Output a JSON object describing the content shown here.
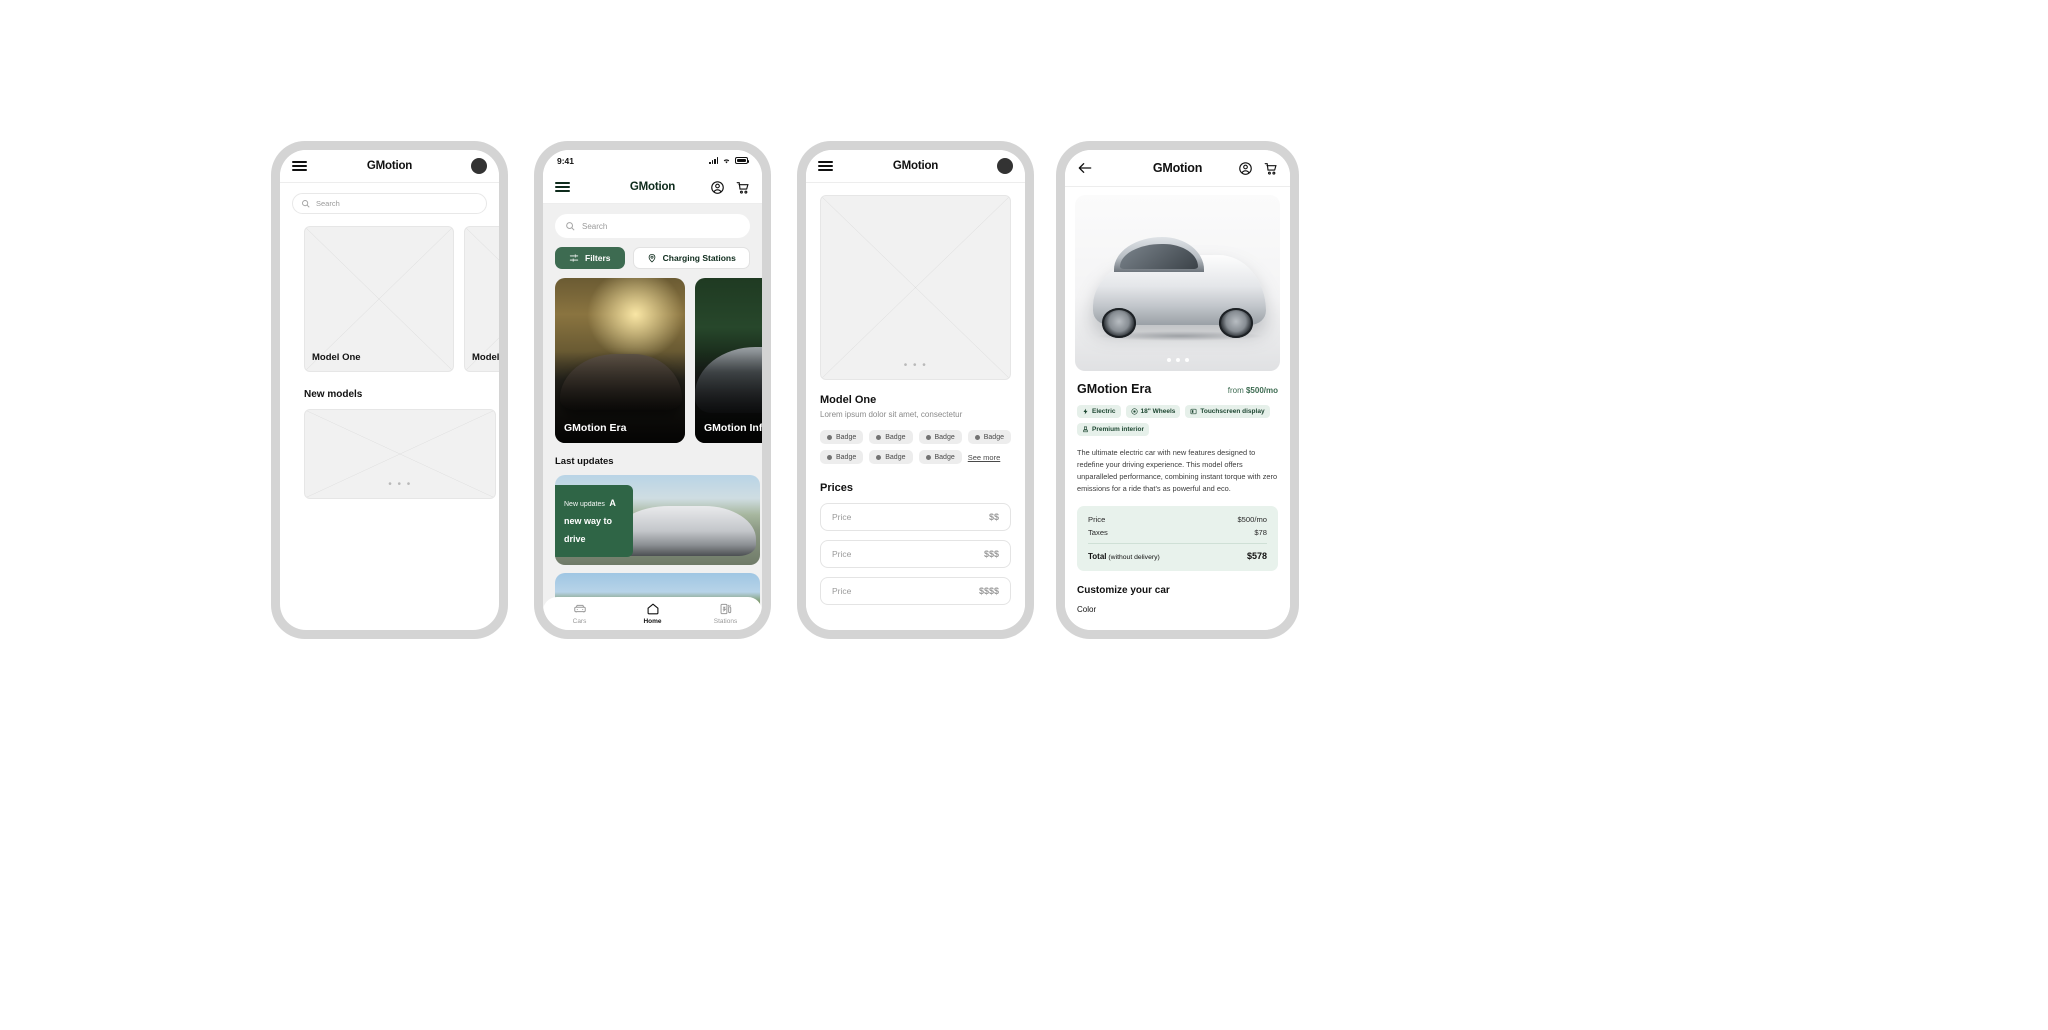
{
  "app": {
    "name": "GMotion"
  },
  "phone1": {
    "appbar": {
      "title": "GMotion",
      "menu_icon": "hamburger-icon",
      "avatar_icon": "avatar-icon"
    },
    "search": {
      "placeholder": "Search",
      "icon": "search-icon"
    },
    "cards": [
      {
        "label": "Model One"
      },
      {
        "label": "Model"
      }
    ],
    "section_title": "New models",
    "new_model_placeholder_dots": "• • •"
  },
  "phone2": {
    "statusbar": {
      "time": "9:41",
      "signal_icon": "cellular-signal-icon",
      "wifi_icon": "wifi-icon",
      "battery_icon": "battery-icon"
    },
    "appbar": {
      "title": "GMotion",
      "menu_icon": "hamburger-icon",
      "account_icon": "account-circle-icon",
      "cart_icon": "shopping-cart-icon"
    },
    "search": {
      "placeholder": "Search",
      "icon": "search-icon"
    },
    "buttons": [
      {
        "label": "Filters",
        "icon": "filter-sliders-icon",
        "style": "filled"
      },
      {
        "label": "Charging Stations",
        "icon": "map-pin-icon",
        "style": "outline"
      }
    ],
    "cards": [
      {
        "label": "GMotion Era"
      },
      {
        "label": "GMotion Infinity"
      }
    ],
    "last_updates_title": "Last updates",
    "update_banner": {
      "kicker": "New updates",
      "headline": "A new way to drive"
    },
    "tabbar": [
      {
        "label": "Cars",
        "icon": "car-icon",
        "active": false
      },
      {
        "label": "Home",
        "icon": "home-icon",
        "active": true
      },
      {
        "label": "Stations",
        "icon": "charging-station-icon",
        "active": false
      }
    ]
  },
  "phone3": {
    "appbar": {
      "title": "GMotion",
      "menu_icon": "hamburger-icon",
      "avatar_icon": "avatar-icon"
    },
    "hero_dots": "• • •",
    "title": "Model One",
    "subtitle": "Lorem ipsum dolor sit amet, consectetur",
    "badges": [
      "Badge",
      "Badge",
      "Badge",
      "Badge",
      "Badge",
      "Badge",
      "Badge"
    ],
    "see_more": "See more",
    "prices_title": "Prices",
    "price_fields": [
      {
        "label": "Price",
        "value": "$$"
      },
      {
        "label": "Price",
        "value": "$$$"
      },
      {
        "label": "Price",
        "value": "$$$$"
      }
    ]
  },
  "phone4": {
    "appbar": {
      "title": "GMotion",
      "back_icon": "arrow-left-icon",
      "account_icon": "account-circle-icon",
      "cart_icon": "shopping-cart-icon"
    },
    "gallery": {
      "dots": 3,
      "active_dot": 1
    },
    "name": "GMotion Era",
    "price_from_prefix": "from ",
    "price_from_value": "$500/mo",
    "feature_badges": [
      {
        "label": "Electric",
        "icon": "bolt-icon"
      },
      {
        "label": "18\" Wheels",
        "icon": "wheel-icon"
      },
      {
        "label": "Touchscreen display",
        "icon": "display-icon"
      },
      {
        "label": "Premium interior",
        "icon": "seat-icon"
      }
    ],
    "description": "The ultimate electric car with new features designed to redefine your driving experience. This model offers unparalleled performance, combining instant torque with zero emissions for a ride that's as powerful and eco.",
    "price_rows": [
      {
        "label": "Price",
        "value": "$500/mo"
      },
      {
        "label": "Taxes",
        "value": "$78"
      }
    ],
    "total": {
      "label": "Total",
      "note": " (without delivery)",
      "value": "$578"
    },
    "customize_title": "Customize your car",
    "color_label": "Color"
  },
  "colors": {
    "brand_green": "#3d6b51",
    "brand_dark": "#0e2b1c",
    "badge_green_bg": "#e6f0ea",
    "price_box_bg": "#e8f2ec",
    "frame_gray": "#d4d4d4",
    "placeholder_gray": "#f1f1f1"
  }
}
